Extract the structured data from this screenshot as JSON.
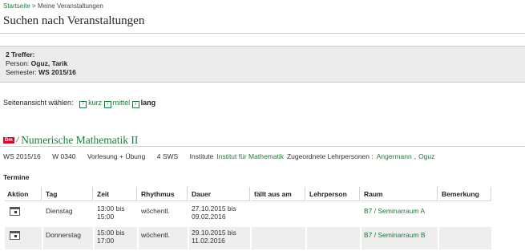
{
  "breadcrumb": {
    "home": "Startseite",
    "sep": ">",
    "current": "Meine Veranstaltungen"
  },
  "page_title": "Suchen nach Veranstaltungen",
  "results": {
    "count": "2 Treffer:",
    "person_label": "Person:",
    "person_value": "Oguz, Tarik",
    "semester_label": "Semester:",
    "semester_value": "WS 2015/16"
  },
  "page_view": {
    "label": "Seitenansicht wählen:",
    "options": [
      "kurz",
      "mittel",
      "lang"
    ],
    "current": "lang"
  },
  "course": {
    "badge": "Dm",
    "title": "Numerische Mathematik II",
    "semester": "WS 2015/16",
    "number": "W 0340",
    "type": "Vorlesung + Übung",
    "sws": "4 SWS",
    "institute_label": "Institute",
    "institute": "Institut für Mathematik",
    "lecturers_label": "Zugeordnete Lehrpersonen :",
    "lecturer1": "Angermann",
    "lecturer_sep": ",",
    "lecturer2": "Oguz"
  },
  "termine": {
    "heading": "Termine",
    "columns": [
      "Aktion",
      "Tag",
      "Zeit",
      "Rhythmus",
      "Dauer",
      "fällt aus am",
      "Lehrperson",
      "Raum",
      "Bemerkung"
    ],
    "rows": [
      {
        "tag": "Dienstag",
        "zeit1": "13:00 bis",
        "zeit2": "15:00",
        "rhythmus": "wöchentl.",
        "dauer1": "27.10.2015 bis",
        "dauer2": "09.02.2016",
        "faellt": "",
        "lehrperson": "",
        "raum": "B7 / Seminarraum A",
        "bemerkung": ""
      },
      {
        "tag": "Donnerstag",
        "zeit1": "15:00 bis",
        "zeit2": "17:00",
        "rhythmus": "wöchentl.",
        "dauer1": "29.10.2015 bis",
        "dauer2": "11.02.2016",
        "faellt": "",
        "lehrperson": "",
        "raum": "B7 / Seminarraum B",
        "bemerkung": ""
      }
    ]
  },
  "colors": {
    "link": "#1d7a3e",
    "badge": "#c8102e",
    "infobox_bg": "#ececec",
    "alt_row": "#eeeeee"
  },
  "icons": {
    "row_action": "calendar-icon",
    "view_option": "arrow-box-icon",
    "course_doc": "document-icon"
  }
}
